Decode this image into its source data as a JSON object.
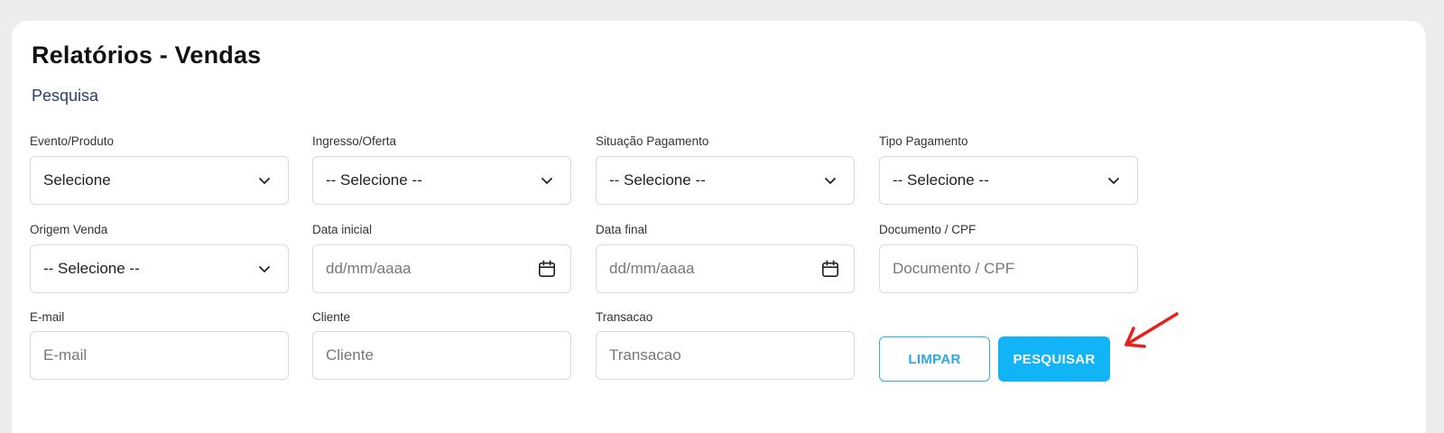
{
  "page": {
    "title": "Relatórios - Vendas",
    "subtitle": "Pesquisa"
  },
  "filters": {
    "evento_produto": {
      "label": "Evento/Produto",
      "value": "Selecione",
      "icon": "chevron-down-icon"
    },
    "ingresso_oferta": {
      "label": "Ingresso/Oferta",
      "value": "-- Selecione --",
      "icon": "chevron-down-icon"
    },
    "situacao_pagamento": {
      "label": "Situação Pagamento",
      "value": "-- Selecione --",
      "icon": "chevron-down-icon"
    },
    "tipo_pagamento": {
      "label": "Tipo Pagamento",
      "value": "-- Selecione --",
      "icon": "chevron-down-icon"
    },
    "origem_venda": {
      "label": "Origem Venda",
      "value": "-- Selecione --",
      "icon": "chevron-down-icon"
    },
    "data_inicial": {
      "label": "Data inicial",
      "placeholder": "dd/mm/aaaa",
      "icon": "calendar-icon"
    },
    "data_final": {
      "label": "Data final",
      "placeholder": "dd/mm/aaaa",
      "icon": "calendar-icon"
    },
    "documento_cpf": {
      "label": "Documento / CPF",
      "placeholder": "Documento / CPF"
    },
    "email": {
      "label": "E-mail",
      "placeholder": "E-mail"
    },
    "cliente": {
      "label": "Cliente",
      "placeholder": "Cliente"
    },
    "transacao": {
      "label": "Transacao",
      "placeholder": "Transacao"
    }
  },
  "actions": {
    "clear_label": "LIMPAR",
    "search_label": "PESQUISAR"
  },
  "colors": {
    "primary": "#10b4f7",
    "annotation_arrow": "#e8201c"
  }
}
